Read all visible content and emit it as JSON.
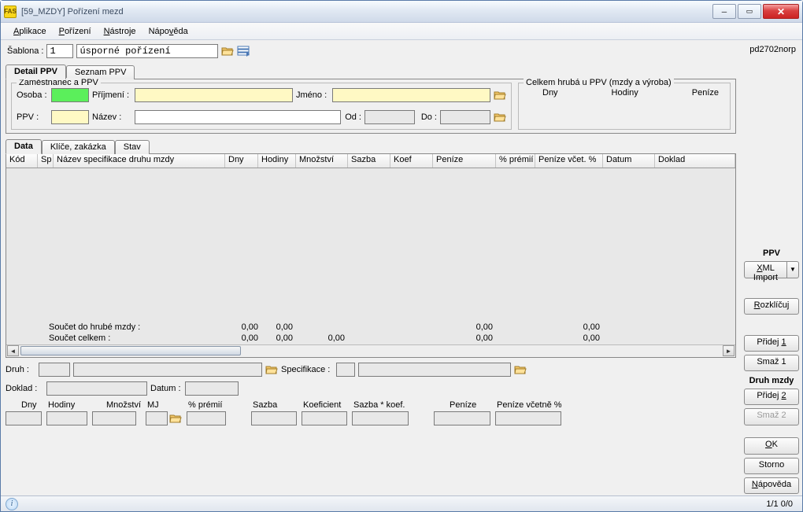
{
  "window": {
    "title": "[59_MZDY] Pořízení mezd"
  },
  "menu": {
    "app": "Aplikace",
    "porizeni": "Pořízení",
    "nastroje": "Nástroje",
    "napoveda": "Nápověda"
  },
  "sablona": {
    "label": "Šablona :",
    "num": "1",
    "name": "úsporné pořízení"
  },
  "user": "pd2702norp",
  "tabs1": {
    "detail": "Detail PPV",
    "seznam": "Seznam PPV"
  },
  "zam": {
    "legend": "Zaměstnanec a PPV",
    "osoba": "Osoba :",
    "prijmeni": "Příjmení :",
    "jmeno": "Jméno :",
    "ppv": "PPV :",
    "nazev": "Název :",
    "od": "Od :",
    "do": "Do :"
  },
  "hruba": {
    "legend": "Celkem hrubá u PPV (mzdy a výroba)",
    "dny": "Dny",
    "hodiny": "Hodiny",
    "penize": "Peníze"
  },
  "tabs2": {
    "data": "Data",
    "klice": "Klíče, zakázka",
    "stav": "Stav"
  },
  "grid": {
    "cols": {
      "kod": "Kód",
      "sp": "Sp",
      "nazev": "Název specifikace druhu mzdy",
      "dny": "Dny",
      "hodiny": "Hodiny",
      "mnoz": "Množství",
      "sazba": "Sazba",
      "koef": "Koef",
      "penize": "Peníze",
      "pprem": "% prémií",
      "pvcet": "Peníze včet. %",
      "datum": "Datum",
      "doklad": "Doklad"
    },
    "sum1_label": "Součet do hrubé mzdy :",
    "sum2_label": "Součet celkem :",
    "sum1": {
      "dny": "0,00",
      "hodiny": "0,00",
      "penize": "0,00",
      "pvcet": "0,00"
    },
    "sum2": {
      "dny": "0,00",
      "hodiny": "0,00",
      "mnoz": "0,00",
      "penize": "0,00",
      "pvcet": "0,00"
    }
  },
  "bottom": {
    "druh": "Druh :",
    "spec": "Specifikace :",
    "doklad": "Doklad :",
    "datum": "Datum :",
    "cols": {
      "dny": "Dny",
      "hodiny": "Hodiny",
      "mnoz": "Množství",
      "mj": "MJ",
      "pprem": "% prémií",
      "sazba": "Sazba",
      "koef": "Koeficient",
      "sk": "Sazba * koef.",
      "penize": "Peníze",
      "pvcet": "Peníze včetně %"
    }
  },
  "right": {
    "ppv": "PPV",
    "xml": "XML Import",
    "rozklicuj": "Rozklíčuj",
    "pridej1": "Přidej 1",
    "smaz1": "Smaž 1",
    "druh": "Druh mzdy",
    "pridej2": "Přidej 2",
    "smaz2": "Smaž 2",
    "ok": "OK",
    "storno": "Storno",
    "napoveda": "Nápověda"
  },
  "status": {
    "pages": "1/1  0/0"
  }
}
